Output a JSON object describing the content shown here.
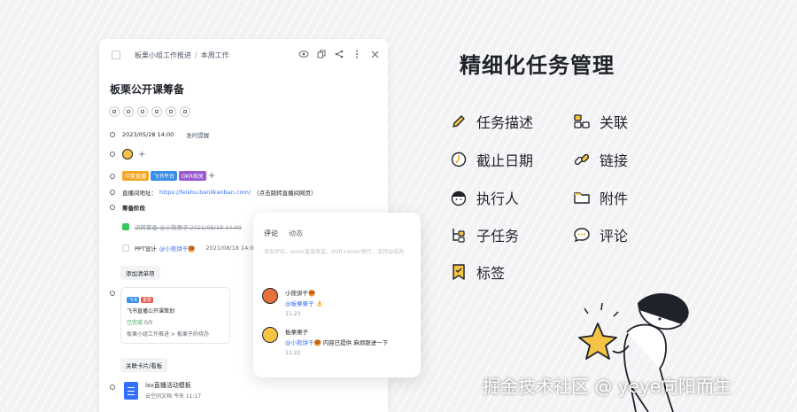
{
  "card": {
    "breadcrumb": [
      "板栗小组工作推进",
      "本周工作"
    ],
    "breadcrumb_sep": "/",
    "title": "板栗公开课筹备",
    "due_date": "2023/05/28 14:00",
    "remind": "准时提醒",
    "tags": [
      {
        "label": "华笑直播",
        "color": "#f5a623"
      },
      {
        "label": "飞书平台",
        "color": "#3a8ee6"
      },
      {
        "label": "OKR相关",
        "color": "#9b59d0"
      }
    ],
    "desc_prefix": "直播间地址：",
    "desc_link": "https://feishu.banlikanban.com/",
    "desc_suffix": "（点击跳转直播间网页）",
    "section": "筹备阶段",
    "subtask1": "讲转筹备  @小熊栗子 2021/08/18 14:00",
    "subtask2_name": "PPT设计",
    "subtask2_at": "@小熊饼干🥮",
    "subtask2_date": "2021/08/18 14:00",
    "add_checklist": "添加清单项",
    "mini": {
      "tag1": "飞书",
      "tag2": "重要",
      "title": "飞书直播公开课策划",
      "status": "已完成",
      "progress": "0/5",
      "path": "板栗小组工作推进 > 板栗子的待办"
    },
    "related": "关联卡片/看板",
    "doc_name": "isv直播活动模板",
    "doc_meta": "云空间文档   今天 11:17"
  },
  "comments": {
    "tab_comment": "评论",
    "tab_activity": "动态",
    "placeholder": "添加评论，enter直接发送，shift+enter换行，支持@成员",
    "items": [
      {
        "name": "小熊饼干🥮",
        "text_at": "@板栗栗子",
        "text": " 👌",
        "time": "11:23",
        "avatar": "#e8703a"
      },
      {
        "name": "板栗栗子",
        "text_at": "@小熊饼干🥮",
        "text": " 内容已提供 麻烦跟进一下",
        "time": "11:22",
        "avatar": "#f6c445"
      }
    ]
  },
  "headline": "精细化任务管理",
  "features": [
    {
      "label": "任务描述",
      "icon": "pencil-icon"
    },
    {
      "label": "关联",
      "icon": "relation-icon"
    },
    {
      "label": "截止日期",
      "icon": "clock-icon"
    },
    {
      "label": "链接",
      "icon": "link-icon"
    },
    {
      "label": "执行人",
      "icon": "person-icon"
    },
    {
      "label": "附件",
      "icon": "folder-icon"
    },
    {
      "label": "子任务",
      "icon": "subtask-icon"
    },
    {
      "label": "评论",
      "icon": "comment-icon"
    },
    {
      "label": "标签",
      "icon": "tag-icon"
    }
  ],
  "watermark": "掘金技术社区 @ yeye向阳而生",
  "colors": {
    "accent": "#f6c445",
    "link": "#3370ff"
  }
}
